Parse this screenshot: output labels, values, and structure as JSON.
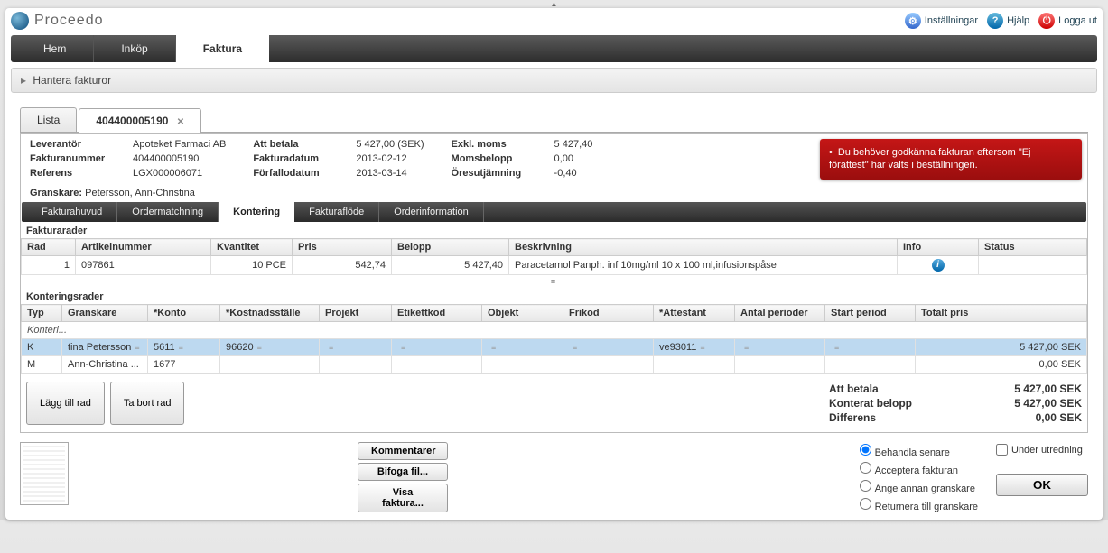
{
  "brand": "Proceedo",
  "header": {
    "settings": "Inställningar",
    "help": "Hjälp",
    "logout": "Logga ut"
  },
  "nav": {
    "home": "Hem",
    "purchase": "Inköp",
    "invoice": "Faktura"
  },
  "breadcrumb": "Hantera fakturor",
  "subtabs": {
    "list": "Lista",
    "num": "404400005190"
  },
  "info": {
    "supplier_lbl": "Leverantör",
    "supplier_val": "Apoteket Farmaci AB",
    "invnum_lbl": "Fakturanummer",
    "invnum_val": "404400005190",
    "ref_lbl": "Referens",
    "ref_val": "LGX000006071",
    "pay_lbl": "Att betala",
    "pay_val": "5 427,00 (SEK)",
    "date_lbl": "Fakturadatum",
    "date_val": "2013-02-12",
    "due_lbl": "Förfallodatum",
    "due_val": "2013-03-14",
    "exvat_lbl": "Exkl. moms",
    "exvat_val": "5 427,40",
    "vat_lbl": "Momsbelopp",
    "vat_val": "0,00",
    "round_lbl": "Öresutjämning",
    "round_val": "-0,40"
  },
  "alert": "Du behöver godkänna fakturan eftersom \"Ej förattest\" har valts i beställningen.",
  "reviewer_label": "Granskare:",
  "reviewer_name": "Petersson, Ann-Christina",
  "innertabs": {
    "head": "Fakturahuvud",
    "match": "Ordermatchning",
    "acct": "Kontering",
    "flow": "Fakturaflöde",
    "order": "Orderinformation"
  },
  "sec1": "Fakturarader",
  "th1": {
    "row": "Rad",
    "art": "Artikelnummer",
    "qty": "Kvantitet",
    "price": "Pris",
    "amount": "Belopp",
    "desc": "Beskrivning",
    "info": "Info",
    "status": "Status"
  },
  "r1": {
    "row": "1",
    "art": "097861",
    "qty": "10 PCE",
    "price": "542,74",
    "amount": "5 427,40",
    "desc": "Paracetamol Panph. inf 10mg/ml 10 x 100 ml,infusionspåse"
  },
  "sec2": "Konteringsrader",
  "th2": {
    "typ": "Typ",
    "rev": "Granskare",
    "konto": "*Konto",
    "cost": "*Kostnadsställe",
    "proj": "Projekt",
    "etik": "Etikettkod",
    "obj": "Objekt",
    "fri": "Frikod",
    "att": "*Attestant",
    "per": "Antal perioder",
    "start": "Start period",
    "total": "Totalt pris"
  },
  "kcat": "Konteri...",
  "k1": {
    "typ": "K",
    "rev": "tina Petersson",
    "konto": "5611",
    "cost": "96620",
    "att": "ve93011",
    "total": "5 427,00 SEK"
  },
  "k2": {
    "typ": "M",
    "rev": "Ann-Christina ...",
    "konto": "1677",
    "total": "0,00 SEK"
  },
  "btns": {
    "add": "Lägg till rad",
    "remove": "Ta bort rad"
  },
  "totals": {
    "pay_l": "Att betala",
    "pay_v": "5 427,00 SEK",
    "acc_l": "Konterat belopp",
    "acc_v": "5 427,00 SEK",
    "diff_l": "Differens",
    "diff_v": "0,00 SEK"
  },
  "actions": {
    "comment": "Kommentarer",
    "attach": "Bifoga fil...",
    "show": "Visa faktura..."
  },
  "radios": {
    "later": "Behandla senare",
    "accept": "Acceptera fakturan",
    "other": "Ange annan granskare",
    "return": "Returnera till granskare"
  },
  "under_lbl": "Under utredning",
  "ok": "OK"
}
